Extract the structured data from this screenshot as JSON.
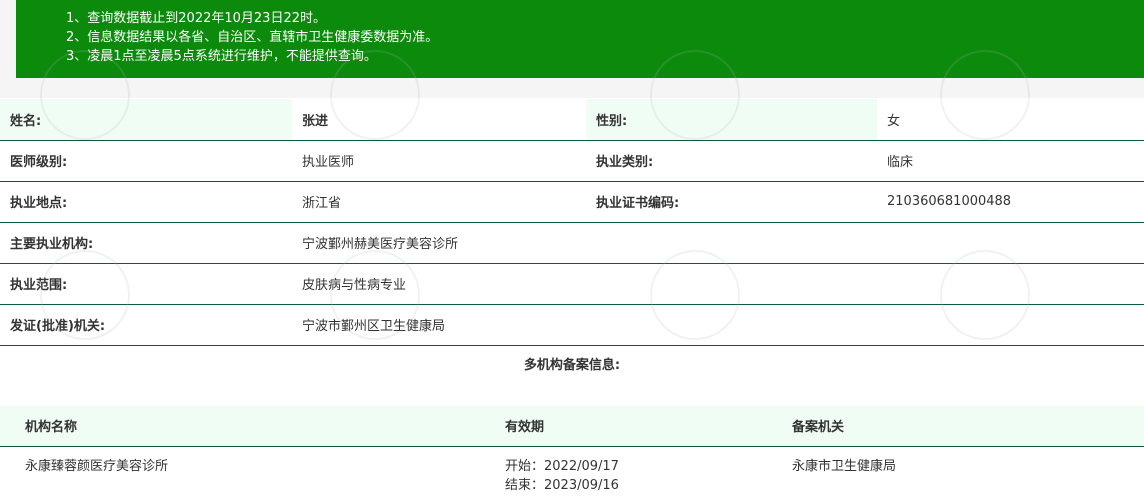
{
  "notice": {
    "lines": [
      "1、查询数据截止到2022年10月23日22时。",
      "2、信息数据结果以各省、自治区、直辖市卫生健康委数据为准。",
      "3、凌晨1点至凌晨5点系统进行维护，不能提供查询。"
    ]
  },
  "info": {
    "name_label": "姓名:",
    "name_value": "张进",
    "gender_label": "性别:",
    "gender_value": "女",
    "level_label": "医师级别:",
    "level_value": "执业医师",
    "category_label": "执业类别:",
    "category_value": "临床",
    "location_label": "执业地点:",
    "location_value": "浙江省",
    "cert_label": "执业证书编码:",
    "cert_value": "210360681000488",
    "institution_label": "主要执业机构:",
    "institution_value": "宁波鄞州赫美医疗美容诊所",
    "scope_label": "执业范围:",
    "scope_value": "皮肤病与性病专业",
    "issuer_label": "发证(批准)机关:",
    "issuer_value": "宁波市鄞州区卫生健康局"
  },
  "multi": {
    "title": "多机构备案信息:",
    "headers": {
      "name": "机构名称",
      "validity": "有效期",
      "authority": "备案机关"
    },
    "rows": [
      {
        "name": "永康臻蓉颜医疗美容诊所",
        "start": "开始：2022/09/17",
        "end": "结束：2023/09/16",
        "authority": "永康市卫生健康局"
      }
    ]
  }
}
